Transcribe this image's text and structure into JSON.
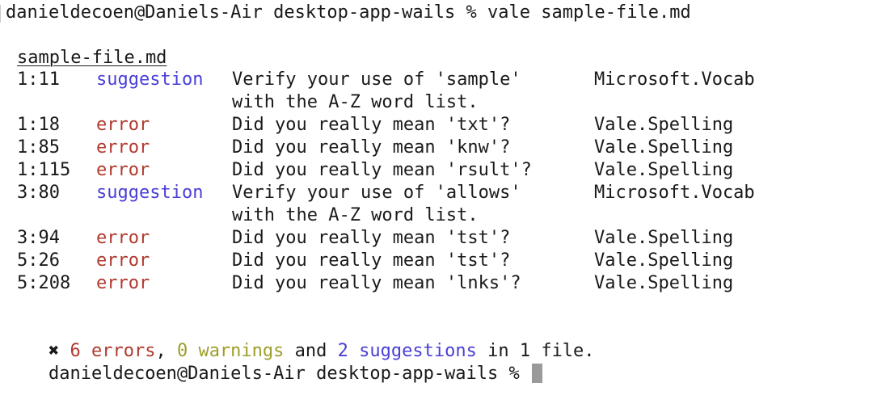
{
  "terminal": {
    "command_line": "danieldecoen@Daniels-Air desktop-app-wails % vale sample-file.md",
    "file_name": "sample-file.md",
    "alerts": [
      {
        "location": "1:11",
        "severity": "suggestion",
        "message": "Verify your use of 'sample'",
        "message_cont": "with the A-Z word list.",
        "rule": "Microsoft.Vocab"
      },
      {
        "location": "1:18",
        "severity": "error",
        "message": "Did you really mean 'txt'?",
        "message_cont": "",
        "rule": "Vale.Spelling"
      },
      {
        "location": "1:85",
        "severity": "error",
        "message": "Did you really mean 'knw'?",
        "message_cont": "",
        "rule": "Vale.Spelling"
      },
      {
        "location": "1:115",
        "severity": "error",
        "message": "Did you really mean 'rsult'?",
        "message_cont": "",
        "rule": "Vale.Spelling"
      },
      {
        "location": "3:80",
        "severity": "suggestion",
        "message": "Verify your use of 'allows'",
        "message_cont": "with the A-Z word list.",
        "rule": "Microsoft.Vocab"
      },
      {
        "location": "3:94",
        "severity": "error",
        "message": "Did you really mean 'tst'?",
        "message_cont": "",
        "rule": "Vale.Spelling"
      },
      {
        "location": "5:26",
        "severity": "error",
        "message": "Did you really mean 'tst'?",
        "message_cont": "",
        "rule": "Vale.Spelling"
      },
      {
        "location": "5:208",
        "severity": "error",
        "message": "Did you really mean 'lnks'?",
        "message_cont": "",
        "rule": "Vale.Spelling"
      }
    ],
    "summary": {
      "x_mark": "✖",
      "errors": "6 errors",
      "sep1": ",",
      "warnings": "0 warnings",
      "and_text": "and",
      "suggestions": "2 suggestions",
      "tail": "in 1 file."
    },
    "prompt_line": "danieldecoen@Daniels-Air desktop-app-wails %"
  },
  "colors": {
    "error": "#b03a2e",
    "suggestion": "#4a3fd6",
    "warning": "#9e9e2a",
    "text": "#1a1a1a",
    "cursor": "#9a9a9a"
  }
}
